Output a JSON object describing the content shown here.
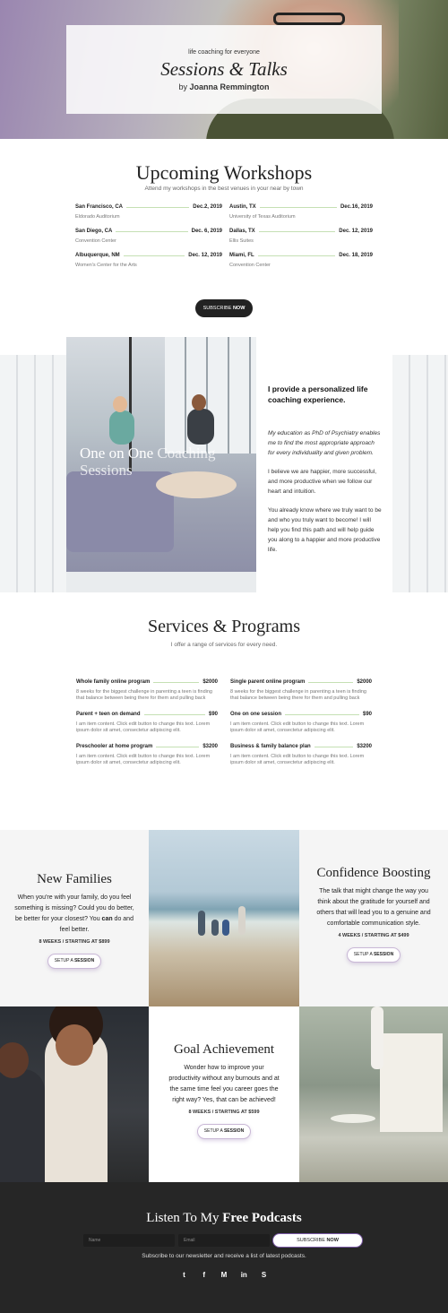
{
  "hero": {
    "tagline": "life coaching for everyone",
    "title": "Sessions & Talks",
    "by_prefix": "by ",
    "author": "Joanna Remmington"
  },
  "workshops": {
    "title": "Upcoming Workshops",
    "subtitle": "Attend my workshops in the best venues in your near by town",
    "left": [
      {
        "city": "San Francisco, CA",
        "date": "Dec.2, 2019",
        "venue": "Eldorado Auditorium"
      },
      {
        "city": "San Diego, CA",
        "date": "Dec. 6, 2019",
        "venue": "Convention Center"
      },
      {
        "city": "Albuquerque, NM",
        "date": "Dec. 12, 2019",
        "venue": "Women's Center for the Arts"
      }
    ],
    "right": [
      {
        "city": "Austin, TX",
        "date": "Dec.16, 2019",
        "venue": "University of Texas Auditorium"
      },
      {
        "city": "Dallas, TX",
        "date": "Dec. 12, 2019",
        "venue": "Ellis Suites"
      },
      {
        "city": "Miami, FL",
        "date": "Dec. 18, 2019",
        "venue": "Convention Center"
      }
    ],
    "subscribe_label": "SUBSCRIBE ",
    "subscribe_bold": "NOW"
  },
  "coaching": {
    "image_caption_1": "One on One",
    "image_caption_2": "Coaching",
    "image_caption_3": "Sessions",
    "heading": "I provide a personalized life coaching experience.",
    "p1": "My education as PhD of Psychiatry enables me to find the most appropriate approach for every individuality and given problem.",
    "p2": "I believe we are happier, more successful, and more productive when we follow our heart and intuition.",
    "p3": "You already know where we truly want to be and who you truly want to become! I will help you find this path and will help guide you along to a happier and more productive life."
  },
  "services": {
    "title": "Services & Programs",
    "subtitle": "I offer a range of services for every need.",
    "left": [
      {
        "name": "Whole family online program",
        "price": "$2000",
        "desc": "8 weeks for the biggest challenge in parenting a teen is finding that balance between being there for them and pulling back"
      },
      {
        "name": "Parent + teen on demand",
        "price": "$90",
        "desc": "I am item content. Click edit button to change this text. Lorem ipsum dolor sit amet, consectetur adipiscing elit."
      },
      {
        "name": "Preschooler at home program",
        "price": "$3200",
        "desc": "I am item content. Click edit button to change this text. Lorem ipsum dolor sit amet, consectetur adipiscing elit."
      }
    ],
    "right": [
      {
        "name": "Single parent online program",
        "price": "$2000",
        "desc": "8 weeks for the biggest challenge in parenting a teen is finding that balance between being there for them and pulling back"
      },
      {
        "name": "One on one session",
        "price": "$90",
        "desc": "I am item content. Click edit button to change this text. Lorem ipsum dolor sit amet, consectetur adipiscing elit."
      },
      {
        "name": "Business & family balance plan",
        "price": "$3200",
        "desc": "I am item content. Click edit button to change this text. Lorem ipsum dolor sit amet, consectetur adipiscing elit."
      }
    ]
  },
  "grid": {
    "new_families": {
      "title": "New Families",
      "text_a": "When you're with your family, do you feel something is missing? Could you do better, be better for your closest? You ",
      "text_bold": "can",
      "text_b": " do and feel better.",
      "meta": "8 WEEKS / STARTING AT $899",
      "btn": "SETUP A ",
      "btn_bold": "SESSION"
    },
    "confidence": {
      "title": "Confidence Boosting",
      "text": "The talk that might change the way you think about the gratitude for yourself and others that will lead you to a genuine and comfortable communication style.",
      "meta": "4 WEEKS / STARTING AT $499",
      "btn": "SETUP A ",
      "btn_bold": "SESSION"
    },
    "goal": {
      "title": "Goal Achievement",
      "text": "Wonder how to improve your productivity without any burnouts and at the same time feel you career goes the right way? Yes, that can be achieved!",
      "meta": "8 WEEKS / STARTING AT $599",
      "btn": "SETUP A ",
      "btn_bold": "SESSION"
    }
  },
  "podcast": {
    "title_a": "Listen To My ",
    "title_b": "Free Podcasts",
    "name_placeholder": "Name",
    "email_placeholder": "Email",
    "btn": "SUBSCRIBE ",
    "btn_bold": "NOW",
    "note": "Subscribe to our newsletter and receive a list of latest podcasts.",
    "socials": [
      {
        "icon": "twitter-icon",
        "glyph": "t"
      },
      {
        "icon": "facebook-icon",
        "glyph": "f"
      },
      {
        "icon": "medium-icon",
        "glyph": "M"
      },
      {
        "icon": "linkedin-icon",
        "glyph": "in"
      },
      {
        "icon": "skype-icon",
        "glyph": "S"
      }
    ]
  }
}
